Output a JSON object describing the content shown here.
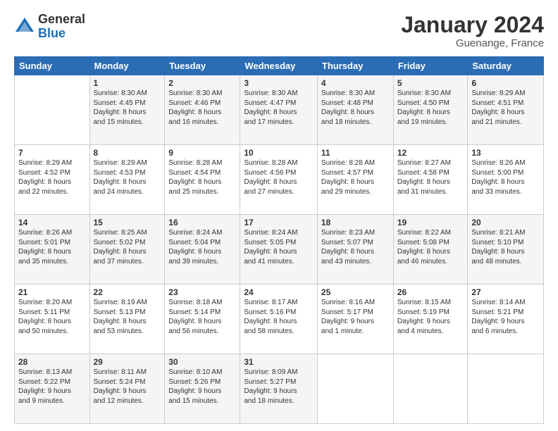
{
  "logo": {
    "general": "General",
    "blue": "Blue"
  },
  "title": "January 2024",
  "location": "Guenange, France",
  "days_header": [
    "Sunday",
    "Monday",
    "Tuesday",
    "Wednesday",
    "Thursday",
    "Friday",
    "Saturday"
  ],
  "weeks": [
    [
      {
        "num": "",
        "info": ""
      },
      {
        "num": "1",
        "info": "Sunrise: 8:30 AM\nSunset: 4:45 PM\nDaylight: 8 hours\nand 15 minutes."
      },
      {
        "num": "2",
        "info": "Sunrise: 8:30 AM\nSunset: 4:46 PM\nDaylight: 8 hours\nand 16 minutes."
      },
      {
        "num": "3",
        "info": "Sunrise: 8:30 AM\nSunset: 4:47 PM\nDaylight: 8 hours\nand 17 minutes."
      },
      {
        "num": "4",
        "info": "Sunrise: 8:30 AM\nSunset: 4:48 PM\nDaylight: 8 hours\nand 18 minutes."
      },
      {
        "num": "5",
        "info": "Sunrise: 8:30 AM\nSunset: 4:50 PM\nDaylight: 8 hours\nand 19 minutes."
      },
      {
        "num": "6",
        "info": "Sunrise: 8:29 AM\nSunset: 4:51 PM\nDaylight: 8 hours\nand 21 minutes."
      }
    ],
    [
      {
        "num": "7",
        "info": "Sunrise: 8:29 AM\nSunset: 4:52 PM\nDaylight: 8 hours\nand 22 minutes."
      },
      {
        "num": "8",
        "info": "Sunrise: 8:29 AM\nSunset: 4:53 PM\nDaylight: 8 hours\nand 24 minutes."
      },
      {
        "num": "9",
        "info": "Sunrise: 8:28 AM\nSunset: 4:54 PM\nDaylight: 8 hours\nand 25 minutes."
      },
      {
        "num": "10",
        "info": "Sunrise: 8:28 AM\nSunset: 4:56 PM\nDaylight: 8 hours\nand 27 minutes."
      },
      {
        "num": "11",
        "info": "Sunrise: 8:28 AM\nSunset: 4:57 PM\nDaylight: 8 hours\nand 29 minutes."
      },
      {
        "num": "12",
        "info": "Sunrise: 8:27 AM\nSunset: 4:58 PM\nDaylight: 8 hours\nand 31 minutes."
      },
      {
        "num": "13",
        "info": "Sunrise: 8:26 AM\nSunset: 5:00 PM\nDaylight: 8 hours\nand 33 minutes."
      }
    ],
    [
      {
        "num": "14",
        "info": "Sunrise: 8:26 AM\nSunset: 5:01 PM\nDaylight: 8 hours\nand 35 minutes."
      },
      {
        "num": "15",
        "info": "Sunrise: 8:25 AM\nSunset: 5:02 PM\nDaylight: 8 hours\nand 37 minutes."
      },
      {
        "num": "16",
        "info": "Sunrise: 8:24 AM\nSunset: 5:04 PM\nDaylight: 8 hours\nand 39 minutes."
      },
      {
        "num": "17",
        "info": "Sunrise: 8:24 AM\nSunset: 5:05 PM\nDaylight: 8 hours\nand 41 minutes."
      },
      {
        "num": "18",
        "info": "Sunrise: 8:23 AM\nSunset: 5:07 PM\nDaylight: 8 hours\nand 43 minutes."
      },
      {
        "num": "19",
        "info": "Sunrise: 8:22 AM\nSunset: 5:08 PM\nDaylight: 8 hours\nand 46 minutes."
      },
      {
        "num": "20",
        "info": "Sunrise: 8:21 AM\nSunset: 5:10 PM\nDaylight: 8 hours\nand 48 minutes."
      }
    ],
    [
      {
        "num": "21",
        "info": "Sunrise: 8:20 AM\nSunset: 5:11 PM\nDaylight: 8 hours\nand 50 minutes."
      },
      {
        "num": "22",
        "info": "Sunrise: 8:19 AM\nSunset: 5:13 PM\nDaylight: 8 hours\nand 53 minutes."
      },
      {
        "num": "23",
        "info": "Sunrise: 8:18 AM\nSunset: 5:14 PM\nDaylight: 8 hours\nand 56 minutes."
      },
      {
        "num": "24",
        "info": "Sunrise: 8:17 AM\nSunset: 5:16 PM\nDaylight: 8 hours\nand 58 minutes."
      },
      {
        "num": "25",
        "info": "Sunrise: 8:16 AM\nSunset: 5:17 PM\nDaylight: 9 hours\nand 1 minute."
      },
      {
        "num": "26",
        "info": "Sunrise: 8:15 AM\nSunset: 5:19 PM\nDaylight: 9 hours\nand 4 minutes."
      },
      {
        "num": "27",
        "info": "Sunrise: 8:14 AM\nSunset: 5:21 PM\nDaylight: 9 hours\nand 6 minutes."
      }
    ],
    [
      {
        "num": "28",
        "info": "Sunrise: 8:13 AM\nSunset: 5:22 PM\nDaylight: 9 hours\nand 9 minutes."
      },
      {
        "num": "29",
        "info": "Sunrise: 8:11 AM\nSunset: 5:24 PM\nDaylight: 9 hours\nand 12 minutes."
      },
      {
        "num": "30",
        "info": "Sunrise: 8:10 AM\nSunset: 5:26 PM\nDaylight: 9 hours\nand 15 minutes."
      },
      {
        "num": "31",
        "info": "Sunrise: 8:09 AM\nSunset: 5:27 PM\nDaylight: 9 hours\nand 18 minutes."
      },
      {
        "num": "",
        "info": ""
      },
      {
        "num": "",
        "info": ""
      },
      {
        "num": "",
        "info": ""
      }
    ]
  ]
}
